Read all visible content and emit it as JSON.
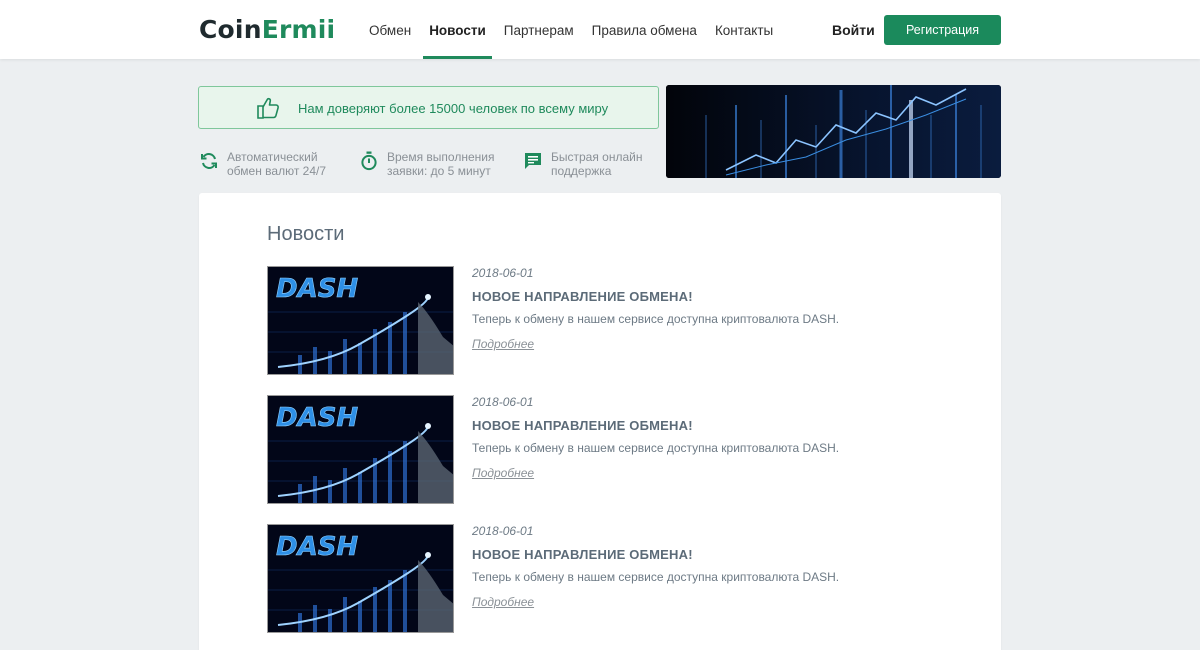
{
  "header": {
    "logo_part1": "Coin",
    "logo_part2": "Ermii",
    "nav": [
      {
        "label": "Обмен"
      },
      {
        "label": "Новости"
      },
      {
        "label": "Партнерам"
      },
      {
        "label": "Правила обмена"
      },
      {
        "label": "Контакты"
      }
    ],
    "active_nav": "Новости",
    "login_label": "Войти",
    "register_label": "Регистрация"
  },
  "trust_banner": {
    "text": "Нам доверяют более 15000 человек по всему миру",
    "icon": "thumbs-up-icon"
  },
  "features": [
    {
      "icon": "refresh-icon",
      "line1": "Автоматический",
      "line2": "обмен валют 24/7"
    },
    {
      "icon": "stopwatch-icon",
      "line1": "Время выполнения",
      "line2": "заявки: до 5 минут"
    },
    {
      "icon": "chat-icon",
      "line1": "Быстрая онлайн",
      "line2": "поддержка"
    }
  ],
  "news": {
    "title": "Новости",
    "items": [
      {
        "image_text": "DASH",
        "date": "2018-06-01",
        "headline": "НОВОЕ НАПРАВЛЕНИЕ ОБМЕНА!",
        "desc": "Теперь к обмену в нашем сервисе доступна криптовалюта DASH.",
        "more": "Подробнее"
      },
      {
        "image_text": "DASH",
        "date": "2018-06-01",
        "headline": "НОВОЕ НАПРАВЛЕНИЕ ОБМЕНА!",
        "desc": "Теперь к обмену в нашем сервисе доступна криптовалюта DASH.",
        "more": "Подробнее"
      },
      {
        "image_text": "DASH",
        "date": "2018-06-01",
        "headline": "НОВОЕ НАПРАВЛЕНИЕ ОБМЕНА!",
        "desc": "Теперь к обмену в нашем сервисе доступна криптовалюта DASH.",
        "more": "Подробнее"
      }
    ]
  },
  "colors": {
    "brand_green": "#1f8a5c",
    "trust_bg": "#e8f5ec",
    "page_bg": "#eceff1"
  }
}
